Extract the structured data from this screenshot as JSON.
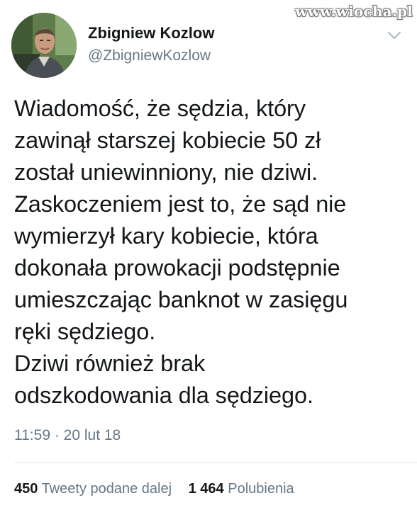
{
  "watermark": "www.wiocha.pl",
  "author": {
    "display_name": "Zbigniew Kozlow",
    "handle": "@ZbigniewKozlow",
    "avatar_icon": "profile-photo"
  },
  "menu_icon": "chevron-down-icon",
  "tweet": {
    "text": "Wiadomość, że sędzia, który\nzawinął starszej kobiecie 50 zł\nzostał uniewinniony, nie dziwi.\nZaskoczeniem jest to, że sąd nie\nwymierzył kary kobiecie, która\ndokonała prowokacji podstępnie\numieszczając banknot w zasięgu\nręki sędziego.\nDziwi również brak\nodszkodowania dla sędziego.",
    "timestamp": "11:59 · 20 lut 18"
  },
  "stats": {
    "retweets_count": "450",
    "retweets_label": "Tweety podane dalej",
    "likes_count": "1 464",
    "likes_label": "Polubienia"
  },
  "colors": {
    "text": "#14171a",
    "secondary": "#657786",
    "divider": "#e1e8ed"
  }
}
